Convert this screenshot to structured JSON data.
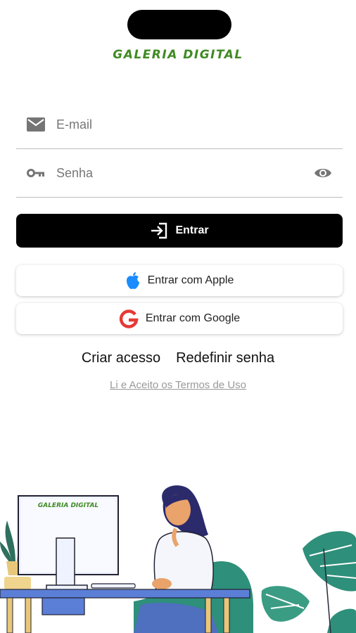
{
  "brand": {
    "name": "GALERIA DIGITAL"
  },
  "login": {
    "email_placeholder": "E-mail",
    "password_placeholder": "Senha",
    "submit_label": "Entrar"
  },
  "social": {
    "apple_label": "Entrar com Apple",
    "google_label": "Entrar com Google"
  },
  "links": {
    "create_account": "Criar acesso",
    "reset_password": "Redefinir senha",
    "terms": "Li e Aceito os Termos de Uso"
  },
  "illustration": {
    "monitor_brand": "GALERIA DIGITAL"
  },
  "colors": {
    "brand_green": "#3f8a23",
    "primary_button": "#000000",
    "apple_blue": "#1a8cff",
    "google_red": "#e53935"
  }
}
